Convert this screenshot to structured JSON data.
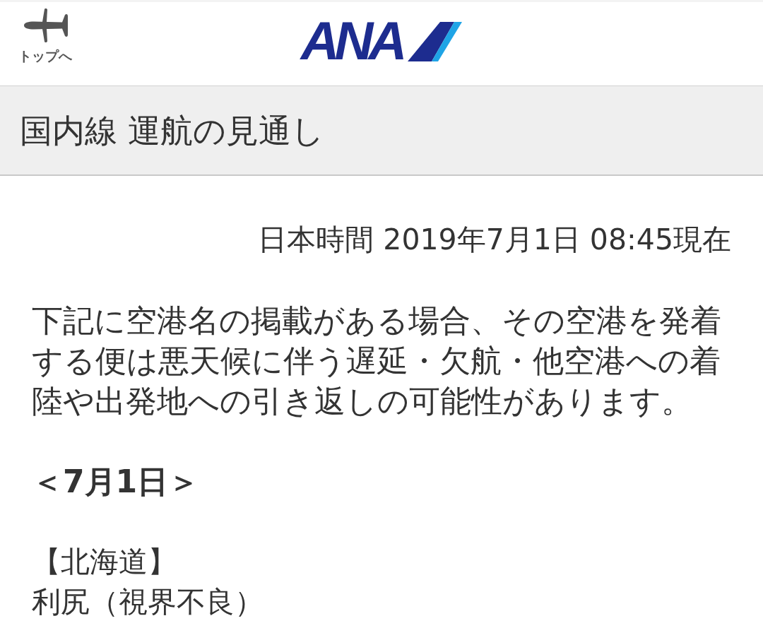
{
  "header": {
    "top_link": {
      "label": "トップへ"
    },
    "logo": {
      "text": "ANA"
    }
  },
  "page_title": "国内線 運航の見通し",
  "timestamp": "日本時間 2019年7月1日 08:45現在",
  "notice": "下記に空港名の掲載がある場合、その空港を発着する便は悪天候に伴う遅延・欠航・他空港への着陸や出発地への引き返しの可能性があります。",
  "sections": [
    {
      "date": "＜7月1日＞",
      "regions": [
        {
          "name": "【北海道】",
          "airports": [
            "利尻（視界不良）"
          ]
        }
      ]
    }
  ]
}
